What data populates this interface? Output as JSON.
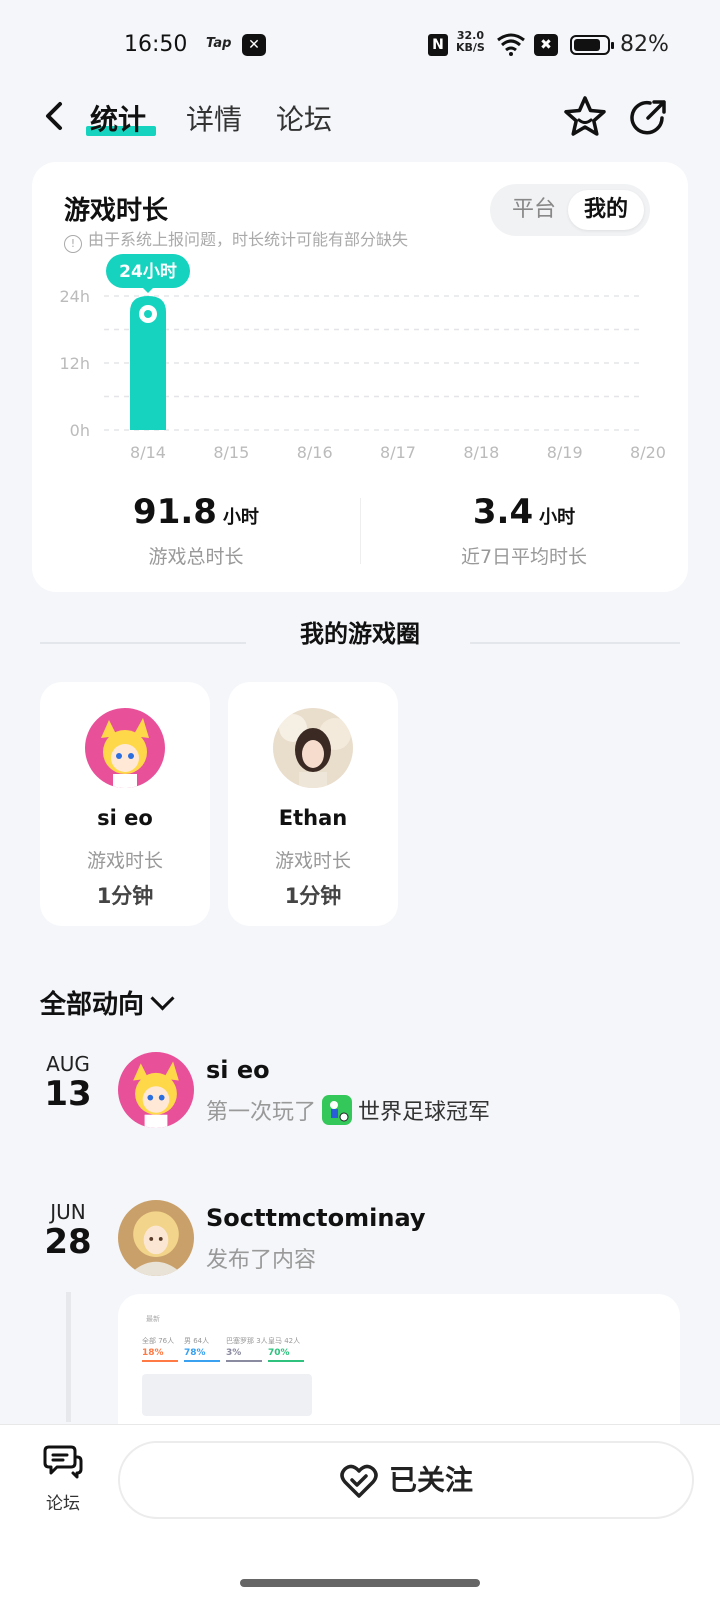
{
  "status_bar": {
    "time": "16:50",
    "tap_label": "Tap",
    "speed_value": "32.0",
    "speed_unit": "KB/S",
    "battery_percent": "82%",
    "battery_level": 0.82
  },
  "nav": {
    "tabs": [
      {
        "label": "统计",
        "active": true
      },
      {
        "label": "详情",
        "active": false
      },
      {
        "label": "论坛",
        "active": false
      }
    ]
  },
  "playtime_card": {
    "title": "游戏时长",
    "note": "由于系统上报问题，时长统计可能有部分缺失",
    "segments": [
      {
        "label": "平台",
        "selected": false
      },
      {
        "label": "我的",
        "selected": true
      }
    ],
    "tooltip": "24小时",
    "total_value": "91.8",
    "total_unit": "小时",
    "total_label": "游戏总时长",
    "avg_value": "3.4",
    "avg_unit": "小时",
    "avg_label": "近7日平均时长"
  },
  "chart_data": {
    "type": "bar",
    "categories": [
      "8/14",
      "8/15",
      "8/16",
      "8/17",
      "8/18",
      "8/19",
      "8/20"
    ],
    "values": [
      24,
      0,
      0,
      0,
      0,
      0,
      0
    ],
    "y_ticks": [
      "24h",
      "12h",
      "0h"
    ],
    "ylim": [
      0,
      24
    ],
    "grid": true,
    "bar_color": "#16d3bf"
  },
  "game_circle": {
    "title": "我的游戏圈",
    "friends": [
      {
        "name": "si eo",
        "label": "游戏时长",
        "value": "1分钟"
      },
      {
        "name": "Ethan",
        "label": "游戏时长",
        "value": "1分钟"
      }
    ]
  },
  "feed": {
    "filter_label": "全部动向",
    "items": [
      {
        "month": "AUG",
        "day": "13",
        "name": "si eo",
        "desc": "第一次玩了",
        "game": "世界足球冠军"
      },
      {
        "month": "JUN",
        "day": "28",
        "name": "Socttmctominay",
        "desc": "发布了内容"
      }
    ],
    "post_preview": {
      "header": "最新",
      "cols": [
        {
          "label": "全部",
          "sub": "76人",
          "value": "18",
          "suffix": "%",
          "color": "#ff7a45"
        },
        {
          "label": "男",
          "sub": "64人",
          "value": "78",
          "suffix": "%",
          "color": "#3aa0f0"
        },
        {
          "label": "巴塞罗那",
          "sub": "3人",
          "value": "3",
          "suffix": "%",
          "color": "#8a8aa0"
        },
        {
          "label": "皇马",
          "sub": "42人",
          "value": "70",
          "suffix": "%",
          "color": "#2ec27e"
        }
      ]
    }
  },
  "bottom_bar": {
    "forum_label": "论坛",
    "follow_label": "已关注"
  },
  "colors": {
    "accent": "#16d3bf",
    "background": "#f4f6f9"
  }
}
